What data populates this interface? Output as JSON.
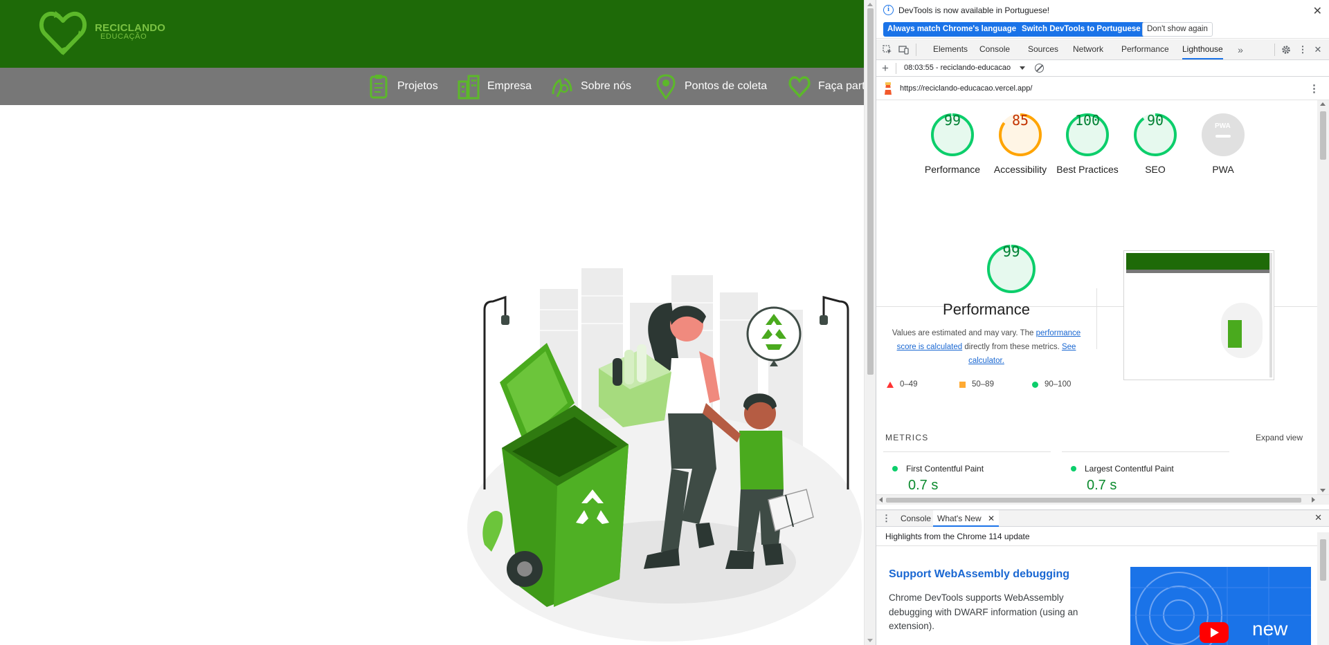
{
  "site": {
    "logo_title": "RECICLANDO",
    "logo_sub": "EDUCAÇÃO",
    "nav": [
      {
        "label": "Projetos",
        "icon": "clipboard-icon"
      },
      {
        "label": "Empresa",
        "icon": "building-icon"
      },
      {
        "label": "Sobre nós",
        "icon": "hands-icon"
      },
      {
        "label": "Pontos de coleta",
        "icon": "map-pin-icon"
      },
      {
        "label": "Faça part",
        "icon": "heart-recycle-icon"
      }
    ],
    "colors": {
      "header": "#1e6a08",
      "nav": "#777777",
      "accent": "#7ac142"
    }
  },
  "devtools": {
    "infobar": {
      "text": "DevTools is now available in Portuguese!",
      "btn_match": "Always match Chrome's language",
      "btn_switch": "Switch DevTools to Portuguese",
      "btn_dismiss": "Don't show again"
    },
    "tabs": [
      "Elements",
      "Console",
      "Sources",
      "Network",
      "Performance",
      "Lighthouse"
    ],
    "active_tab": "Lighthouse",
    "report_select": "08:03:55 - reciclando-educacao",
    "url": "https://reciclando-educacao.vercel.app/",
    "scores": [
      {
        "label": "Performance",
        "value": "99",
        "score": 99,
        "status": "pass"
      },
      {
        "label": "Accessibility",
        "value": "85",
        "score": 85,
        "status": "average"
      },
      {
        "label": "Best Practices",
        "value": "100",
        "score": 100,
        "status": "pass"
      },
      {
        "label": "SEO",
        "value": "90",
        "score": 90,
        "status": "pass"
      },
      {
        "label": "PWA",
        "value": "PWA",
        "score": 0,
        "status": "na"
      }
    ],
    "performance": {
      "value": "99",
      "title": "Performance",
      "desc_1": "Values are estimated and may vary. The ",
      "desc_link1": "performance score is calculated",
      "desc_2": " directly from these metrics. ",
      "desc_link2": "See calculator."
    },
    "legend": [
      {
        "range": "0–49",
        "shape": "triangle",
        "color": "#ff3333"
      },
      {
        "range": "50–89",
        "shape": "square",
        "color": "#ffaa33"
      },
      {
        "range": "90–100",
        "shape": "circle",
        "color": "#0cce6b"
      }
    ],
    "metrics_label": "METRICS",
    "expand_view": "Expand view",
    "metrics": [
      {
        "name": "First Contentful Paint",
        "value": "0.7 s"
      },
      {
        "name": "Largest Contentful Paint",
        "value": "0.7 s"
      }
    ],
    "drawer": {
      "tabs": [
        "Console",
        "What's New"
      ],
      "active": "What's New",
      "subtitle": "Highlights from the Chrome 114 update",
      "headline": "Support WebAssembly debugging",
      "body": "Chrome DevTools supports WebAssembly debugging with DWARF information (using an extension).",
      "video_label": "new"
    },
    "colors": {
      "pass": "#0cce6b",
      "average": "#ffa400",
      "fail": "#ff4e42",
      "link": "#1967d2",
      "accent": "#1a73e8"
    }
  }
}
